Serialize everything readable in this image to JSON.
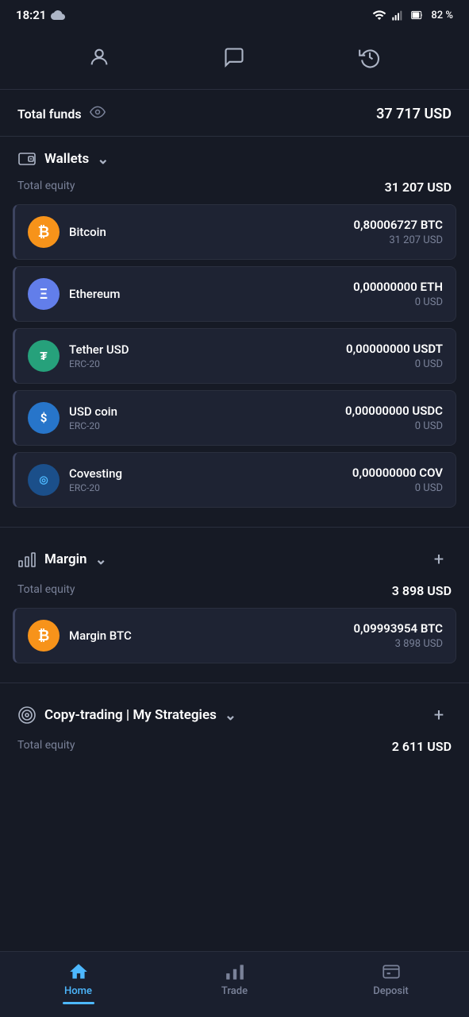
{
  "statusBar": {
    "time": "18:21",
    "battery": "82 %"
  },
  "nav": {
    "profile_icon": "person",
    "chat_icon": "chat",
    "history_icon": "history"
  },
  "totalFunds": {
    "label": "Total funds",
    "amount": "37 717 USD"
  },
  "wallets": {
    "sectionTitle": "Wallets",
    "totalEquityLabel": "Total equity",
    "totalEquityAmount": "31 207 USD",
    "items": [
      {
        "name": "Bitcoin",
        "sub": "",
        "amount": "0,80006727 BTC",
        "usd": "31 207 USD",
        "iconType": "btc",
        "iconSymbol": "₿"
      },
      {
        "name": "Ethereum",
        "sub": "",
        "amount": "0,00000000 ETH",
        "usd": "0 USD",
        "iconType": "eth",
        "iconSymbol": "Ξ"
      },
      {
        "name": "Tether USD",
        "sub": "ERC-20",
        "amount": "0,00000000 USDT",
        "usd": "0 USD",
        "iconType": "usdt",
        "iconSymbol": "₮"
      },
      {
        "name": "USD coin",
        "sub": "ERC-20",
        "amount": "0,00000000 USDC",
        "usd": "0 USD",
        "iconType": "usdc",
        "iconSymbol": "$"
      },
      {
        "name": "Covesting",
        "sub": "ERC-20",
        "amount": "0,00000000 COV",
        "usd": "0 USD",
        "iconType": "cov",
        "iconSymbol": "◎"
      }
    ]
  },
  "margin": {
    "sectionTitle": "Margin",
    "totalEquityLabel": "Total equity",
    "totalEquityAmount": "3 898 USD",
    "items": [
      {
        "name": "Margin BTC",
        "sub": "",
        "amount": "0,09993954 BTC",
        "usd": "3 898 USD",
        "iconType": "margin-btc",
        "iconSymbol": "₿"
      }
    ]
  },
  "copyTrading": {
    "sectionTitle": "Copy-trading | My Strategies",
    "totalEquityLabel": "Total equity",
    "totalEquityAmount": "2 611 USD"
  },
  "bottomNav": {
    "items": [
      {
        "label": "Home",
        "active": true
      },
      {
        "label": "Trade",
        "active": false
      },
      {
        "label": "Deposit",
        "active": false
      }
    ]
  }
}
